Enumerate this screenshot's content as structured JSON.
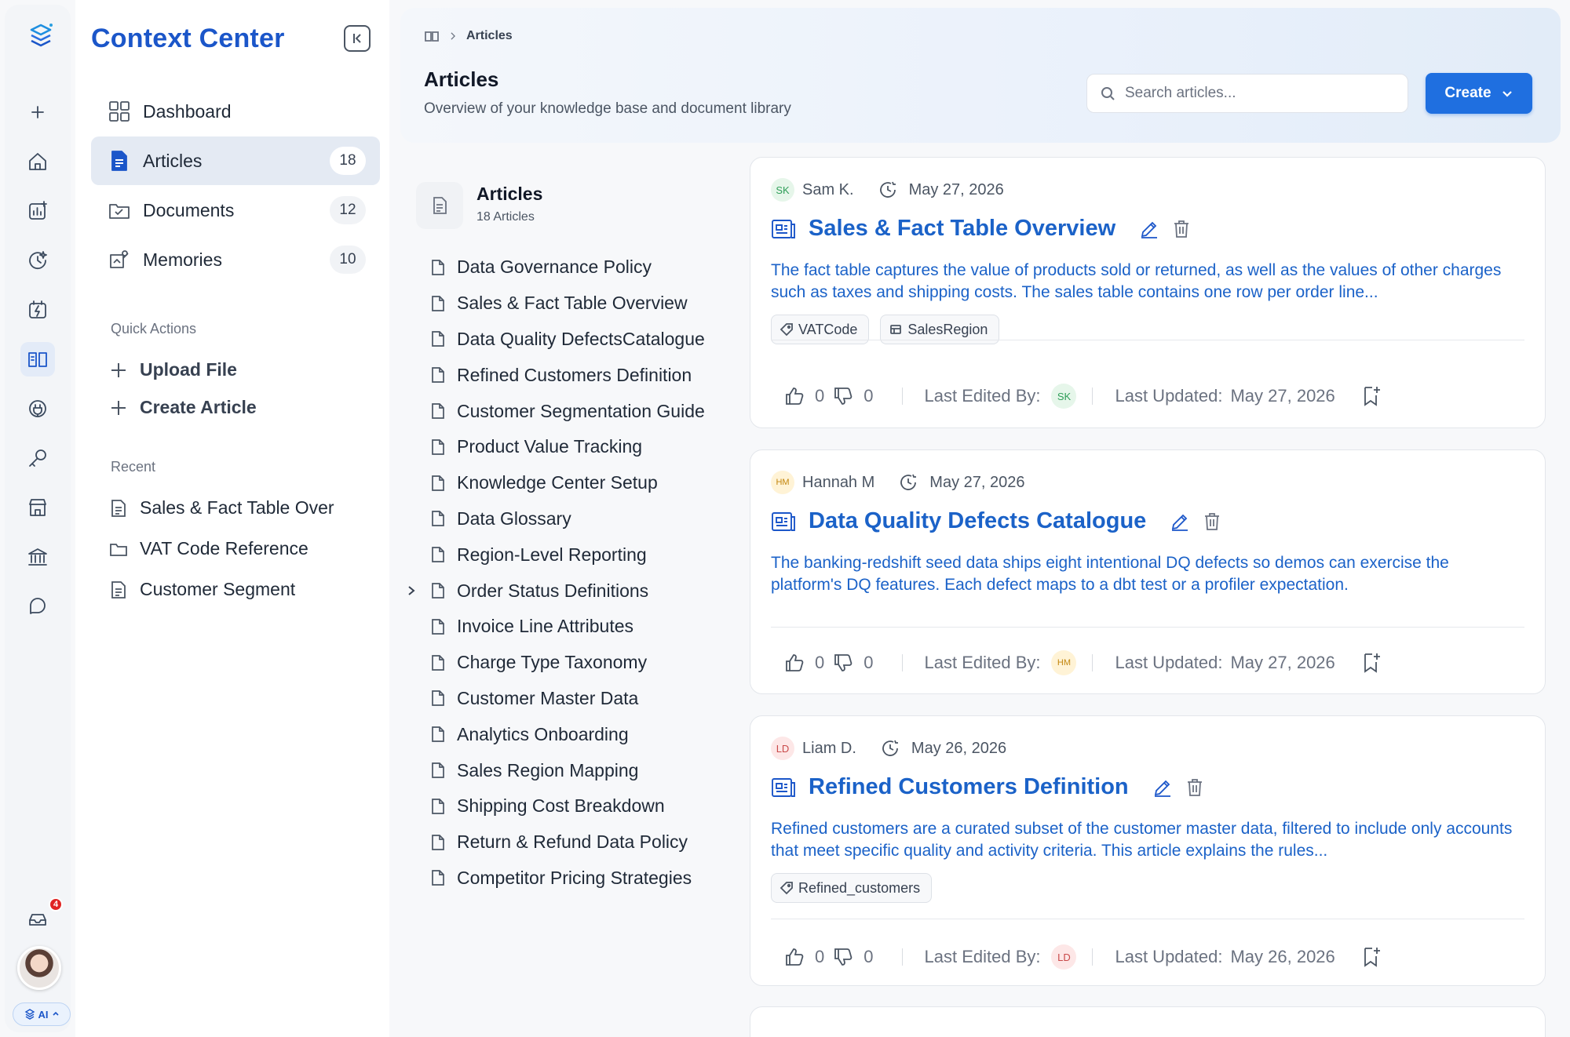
{
  "app": {
    "title": "Context Center"
  },
  "rail": {
    "notification_count": "4",
    "ai_label": "AI"
  },
  "nav": {
    "items": [
      {
        "label": "Dashboard",
        "count": ""
      },
      {
        "label": "Articles",
        "count": "18"
      },
      {
        "label": "Documents",
        "count": "12"
      },
      {
        "label": "Memories",
        "count": "10"
      }
    ],
    "quick_actions_label": "Quick Actions",
    "quick_actions": [
      "Upload File",
      "Create Article"
    ],
    "recent_label": "Recent",
    "recent": [
      "Sales & Fact Table Over",
      "VAT Code Reference",
      "Customer Segment"
    ]
  },
  "header": {
    "breadcrumb": "Articles",
    "title": "Articles",
    "subtitle": "Overview of your knowledge base and document library",
    "search_placeholder": "Search articles...",
    "create_label": "Create"
  },
  "tree": {
    "title": "Articles",
    "count": "18 Articles",
    "items": [
      "Data Governance Policy",
      "Sales & Fact Table Overview",
      "Data Quality DefectsCatalogue",
      "Refined Customers Definition",
      "Customer Segmentation Guide",
      "Product Value Tracking",
      "Knowledge Center Setup",
      "Data Glossary",
      "Region-Level Reporting",
      "Order Status Definitions",
      "Invoice Line Attributes",
      "Charge Type Taxonomy",
      "Customer Master Data",
      "Analytics Onboarding",
      "Sales Region Mapping",
      "Shipping Cost Breakdown",
      "Return & Refund Data Policy",
      "Competitor Pricing Strategies"
    ]
  },
  "cards": [
    {
      "author_initials": "SK",
      "author": "Sam K.",
      "date": "May 27, 2026",
      "title": "Sales & Fact Table Overview",
      "description": "The fact table captures the value of products sold or returned, as well as the values of other charges such as taxes and shipping costs. The sales table contains one row per order line...",
      "tags": [
        "VATCode",
        "SalesRegion"
      ],
      "likes": "0",
      "dislikes": "0",
      "last_edited_label": "Last Edited By:",
      "editor_initials": "SK",
      "last_updated_label": "Last Updated:",
      "last_updated": "May 27, 2026"
    },
    {
      "author_initials": "HM",
      "author": "Hannah M",
      "date": "May 27, 2026",
      "title": "Data Quality Defects Catalogue",
      "description": "The banking-redshift seed data ships eight intentional DQ defects so demos can exercise the platform's DQ features. Each defect maps to a dbt test or a profiler expectation.",
      "tags": [],
      "likes": "0",
      "dislikes": "0",
      "last_edited_label": "Last Edited By:",
      "editor_initials": "HM",
      "last_updated_label": "Last Updated:",
      "last_updated": "May 27, 2026"
    },
    {
      "author_initials": "LD",
      "author": "Liam D.",
      "date": "May 26, 2026",
      "title": "Refined Customers Definition",
      "description": "Refined customers are a curated subset of the customer master data, filtered to include only accounts that meet specific quality and activity criteria. This article explains the rules...",
      "tags": [
        "Refined_customers"
      ],
      "likes": "0",
      "dislikes": "0",
      "last_edited_label": "Last Edited By:",
      "editor_initials": "LD",
      "last_updated_label": "Last Updated:",
      "last_updated": "May 26, 2026"
    }
  ]
}
